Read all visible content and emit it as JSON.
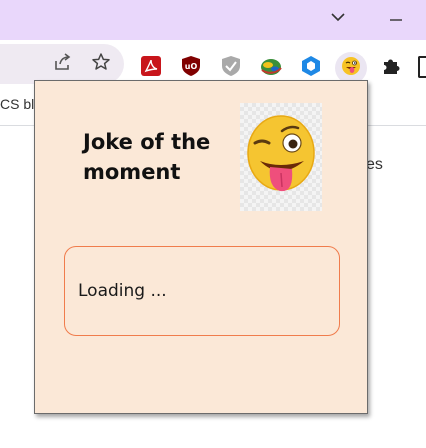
{
  "browser": {
    "bookmark_fragment": "CS blo",
    "page_fragment": "es",
    "window_controls": [
      "chevron-down-icon",
      "minimize-icon"
    ],
    "omnibox_actions": [
      "share-icon",
      "star-icon"
    ],
    "extensions": [
      "acrobat-icon",
      "ublock-icon",
      "shield-icon",
      "joke-globe-icon",
      "hexagon-icon",
      "wink-emoji-icon",
      "puzzle-icon"
    ]
  },
  "popup": {
    "title": "Joke of the moment",
    "joke_text": "Loading ...",
    "image_icon": "wink-tongue-emoji"
  },
  "colors": {
    "titlebar": "#e9d7fb",
    "popup_background": "#fbe8d7",
    "joke_border": "#f07c4c"
  }
}
